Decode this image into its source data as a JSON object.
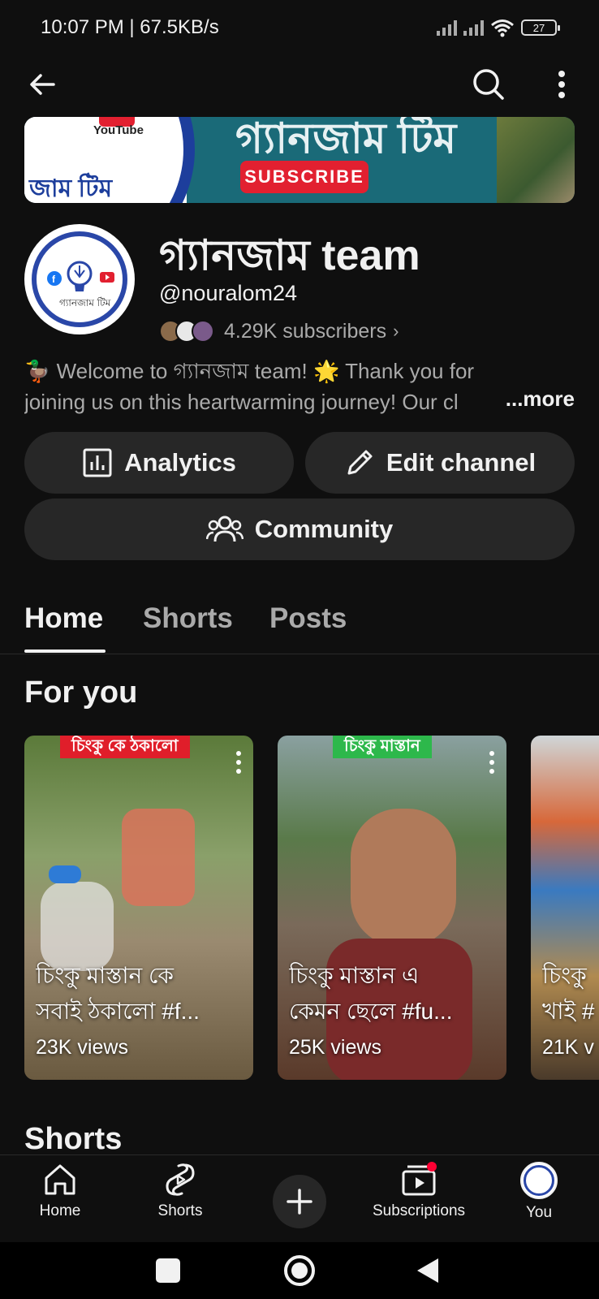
{
  "status_bar": {
    "time": "10:07 PM | 67.5KB/s",
    "battery": "27"
  },
  "app_bar": {
    "back_icon": "arrow-left-icon",
    "search_icon": "search-icon",
    "more_icon": "more-vert-icon"
  },
  "banner": {
    "youtube_text": "YouTube",
    "bengali_left": "জাম টিম",
    "title_text": "গ্যানজাম টিম",
    "subscribe_text": "SUBSCRIBE"
  },
  "channel": {
    "name": "গ্যানজাম team",
    "handle": "@nouralom24",
    "subscribers": "4.29K subscribers",
    "description_line1": "🦆 Welcome to গ্যানজাম team! 🌟 Thank you for",
    "description_line2": "joining us on this heartwarming journey! Our cl",
    "more": "...more"
  },
  "actions": {
    "analytics": "Analytics",
    "edit_channel": "Edit channel",
    "community": "Community"
  },
  "tabs": [
    {
      "label": "Home",
      "active": true
    },
    {
      "label": "Shorts",
      "active": false
    },
    {
      "label": "Posts",
      "active": false
    }
  ],
  "sections": {
    "for_you": "For you",
    "shorts": "Shorts"
  },
  "cards": [
    {
      "tag": "চিংকু কে ঠকালো",
      "tag_color": "#e01e2a",
      "title": "চিংকু মাস্তান কে\nসবাই ঠকালো #f...",
      "views": "23K views"
    },
    {
      "tag": "চিংকু মাস্তান",
      "tag_color": "#2db84b",
      "title": "চিংকু মাস্তান এ\nকেমন ছেলে #fu...",
      "views": "25K views"
    },
    {
      "tag": "",
      "tag_color": "",
      "title": "চিংকু\nখাই #",
      "views": "21K v"
    }
  ],
  "bottom_nav": {
    "home": "Home",
    "shorts": "Shorts",
    "subscriptions": "Subscriptions",
    "you": "You"
  },
  "colors": {
    "background": "#0f0f0f",
    "pill": "#272727",
    "muted_text": "#aaaaaa",
    "notification_dot": "#ff0033"
  }
}
